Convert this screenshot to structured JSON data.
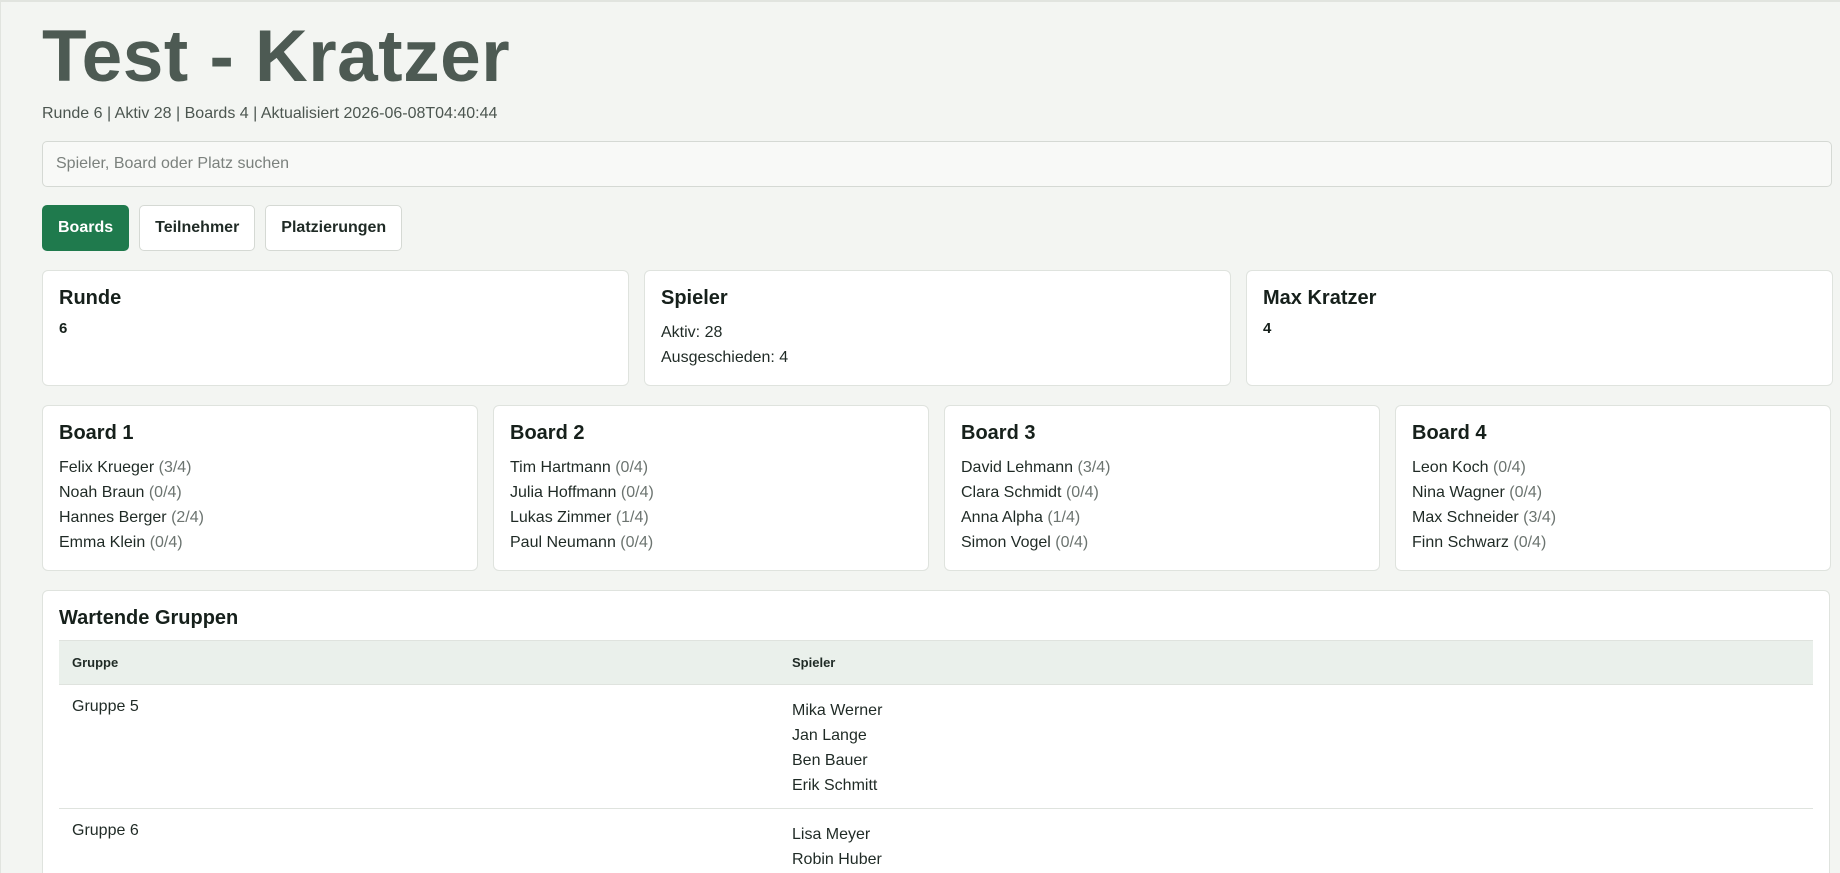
{
  "header": {
    "title": "Test - Kratzer",
    "meta": "Runde 6 | Aktiv 28 | Boards 4 | Aktualisiert 2026-06-08T04:40:44"
  },
  "search": {
    "placeholder": "Spieler, Board oder Platz suchen",
    "value": ""
  },
  "tabs": [
    {
      "label": "Boards",
      "active": true
    },
    {
      "label": "Teilnehmer",
      "active": false
    },
    {
      "label": "Platzierungen",
      "active": false
    }
  ],
  "stats": {
    "runde": {
      "title": "Runde",
      "value": "6"
    },
    "spieler": {
      "title": "Spieler",
      "aktiv": "Aktiv: 28",
      "ausgeschieden": "Ausgeschieden: 4"
    },
    "max_kratzer": {
      "title": "Max Kratzer",
      "value": "4"
    }
  },
  "boards": [
    {
      "title": "Board 1",
      "players": [
        {
          "name": "Felix Krueger",
          "score": "(3/4)"
        },
        {
          "name": "Noah Braun",
          "score": "(0/4)"
        },
        {
          "name": "Hannes Berger",
          "score": "(2/4)"
        },
        {
          "name": "Emma Klein",
          "score": "(0/4)"
        }
      ]
    },
    {
      "title": "Board 2",
      "players": [
        {
          "name": "Tim Hartmann",
          "score": "(0/4)"
        },
        {
          "name": "Julia Hoffmann",
          "score": "(0/4)"
        },
        {
          "name": "Lukas Zimmer",
          "score": "(1/4)"
        },
        {
          "name": "Paul Neumann",
          "score": "(0/4)"
        }
      ]
    },
    {
      "title": "Board 3",
      "players": [
        {
          "name": "David Lehmann",
          "score": "(3/4)"
        },
        {
          "name": "Clara Schmidt",
          "score": "(0/4)"
        },
        {
          "name": "Anna Alpha",
          "score": "(1/4)"
        },
        {
          "name": "Simon Vogel",
          "score": "(0/4)"
        }
      ]
    },
    {
      "title": "Board 4",
      "players": [
        {
          "name": "Leon Koch",
          "score": "(0/4)"
        },
        {
          "name": "Nina Wagner",
          "score": "(0/4)"
        },
        {
          "name": "Max Schneider",
          "score": "(3/4)"
        },
        {
          "name": "Finn Schwarz",
          "score": "(0/4)"
        }
      ]
    }
  ],
  "waiting": {
    "title": "Wartende Gruppen",
    "columns": [
      "Gruppe",
      "Spieler"
    ],
    "rows": [
      {
        "group": "Gruppe 5",
        "players": [
          "Mika Werner",
          "Jan Lange",
          "Ben Bauer",
          "Erik Schmitt"
        ]
      },
      {
        "group": "Gruppe 6",
        "players": [
          "Lisa Meyer",
          "Robin Huber"
        ]
      }
    ]
  },
  "colors": {
    "accent": "#1f7a4d",
    "title": "#4d5a53",
    "background": "#f3f5f2"
  }
}
